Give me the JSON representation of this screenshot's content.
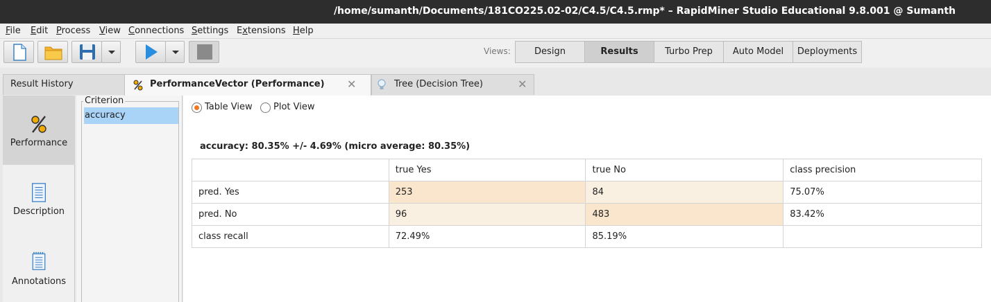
{
  "window": {
    "title": "/home/sumanth/Documents/181CO225.02-02/C4.5/C4.5.rmp* – RapidMiner Studio Educational 9.8.001 @ Sumanth"
  },
  "menu": [
    {
      "label": "File",
      "mnemonic": "F",
      "rest": "ile"
    },
    {
      "label": "Edit",
      "mnemonic": "E",
      "rest": "dit"
    },
    {
      "label": "Process",
      "mnemonic": "P",
      "rest": "rocess"
    },
    {
      "label": "View",
      "mnemonic": "V",
      "rest": "iew"
    },
    {
      "label": "Connections",
      "mnemonic": "C",
      "rest": "onnections"
    },
    {
      "label": "Settings",
      "mnemonic": "S",
      "rest": "ettings"
    },
    {
      "label": "Extensions",
      "mnemonic": "x",
      "pre": "E",
      "rest": "tensions"
    },
    {
      "label": "Help",
      "mnemonic": "H",
      "rest": "elp"
    }
  ],
  "toolbar": {
    "views_label": "Views:",
    "views": [
      "Design",
      "Results",
      "Turbo Prep",
      "Auto Model",
      "Deployments"
    ],
    "active_view": "Results",
    "icons": [
      "new-file-icon",
      "open-folder-icon",
      "save-icon",
      "dropdown-arrow-icon",
      "run-play-icon",
      "stop-icon"
    ]
  },
  "tabs": {
    "history": "Result History",
    "performance": "PerformanceVector (Performance)",
    "tree": "Tree (Decision Tree)",
    "close": "✕"
  },
  "leftnav": [
    {
      "label": "Performance",
      "icon": "percent-icon",
      "active": true
    },
    {
      "label": "Description",
      "icon": "document-icon",
      "active": false
    },
    {
      "label": "Annotations",
      "icon": "notes-icon",
      "active": false
    }
  ],
  "criterion": {
    "legend": "Criterion",
    "selected": "accuracy"
  },
  "view_options": {
    "table": "Table View",
    "plot": "Plot View",
    "selected": "Table View"
  },
  "result": {
    "summary": "accuracy: 80.35% +/- 4.69% (micro average: 80.35%)",
    "headers": [
      "",
      "true Yes",
      "true No",
      "class precision"
    ],
    "rows": [
      [
        "pred. Yes",
        "253",
        "84",
        "75.07%"
      ],
      [
        "pred. No",
        "96",
        "483",
        "83.42%"
      ],
      [
        "class recall",
        "72.49%",
        "85.19%",
        ""
      ]
    ],
    "colors": {
      "correct": "#fae5cd",
      "incorrect": "#faf0e2"
    }
  }
}
